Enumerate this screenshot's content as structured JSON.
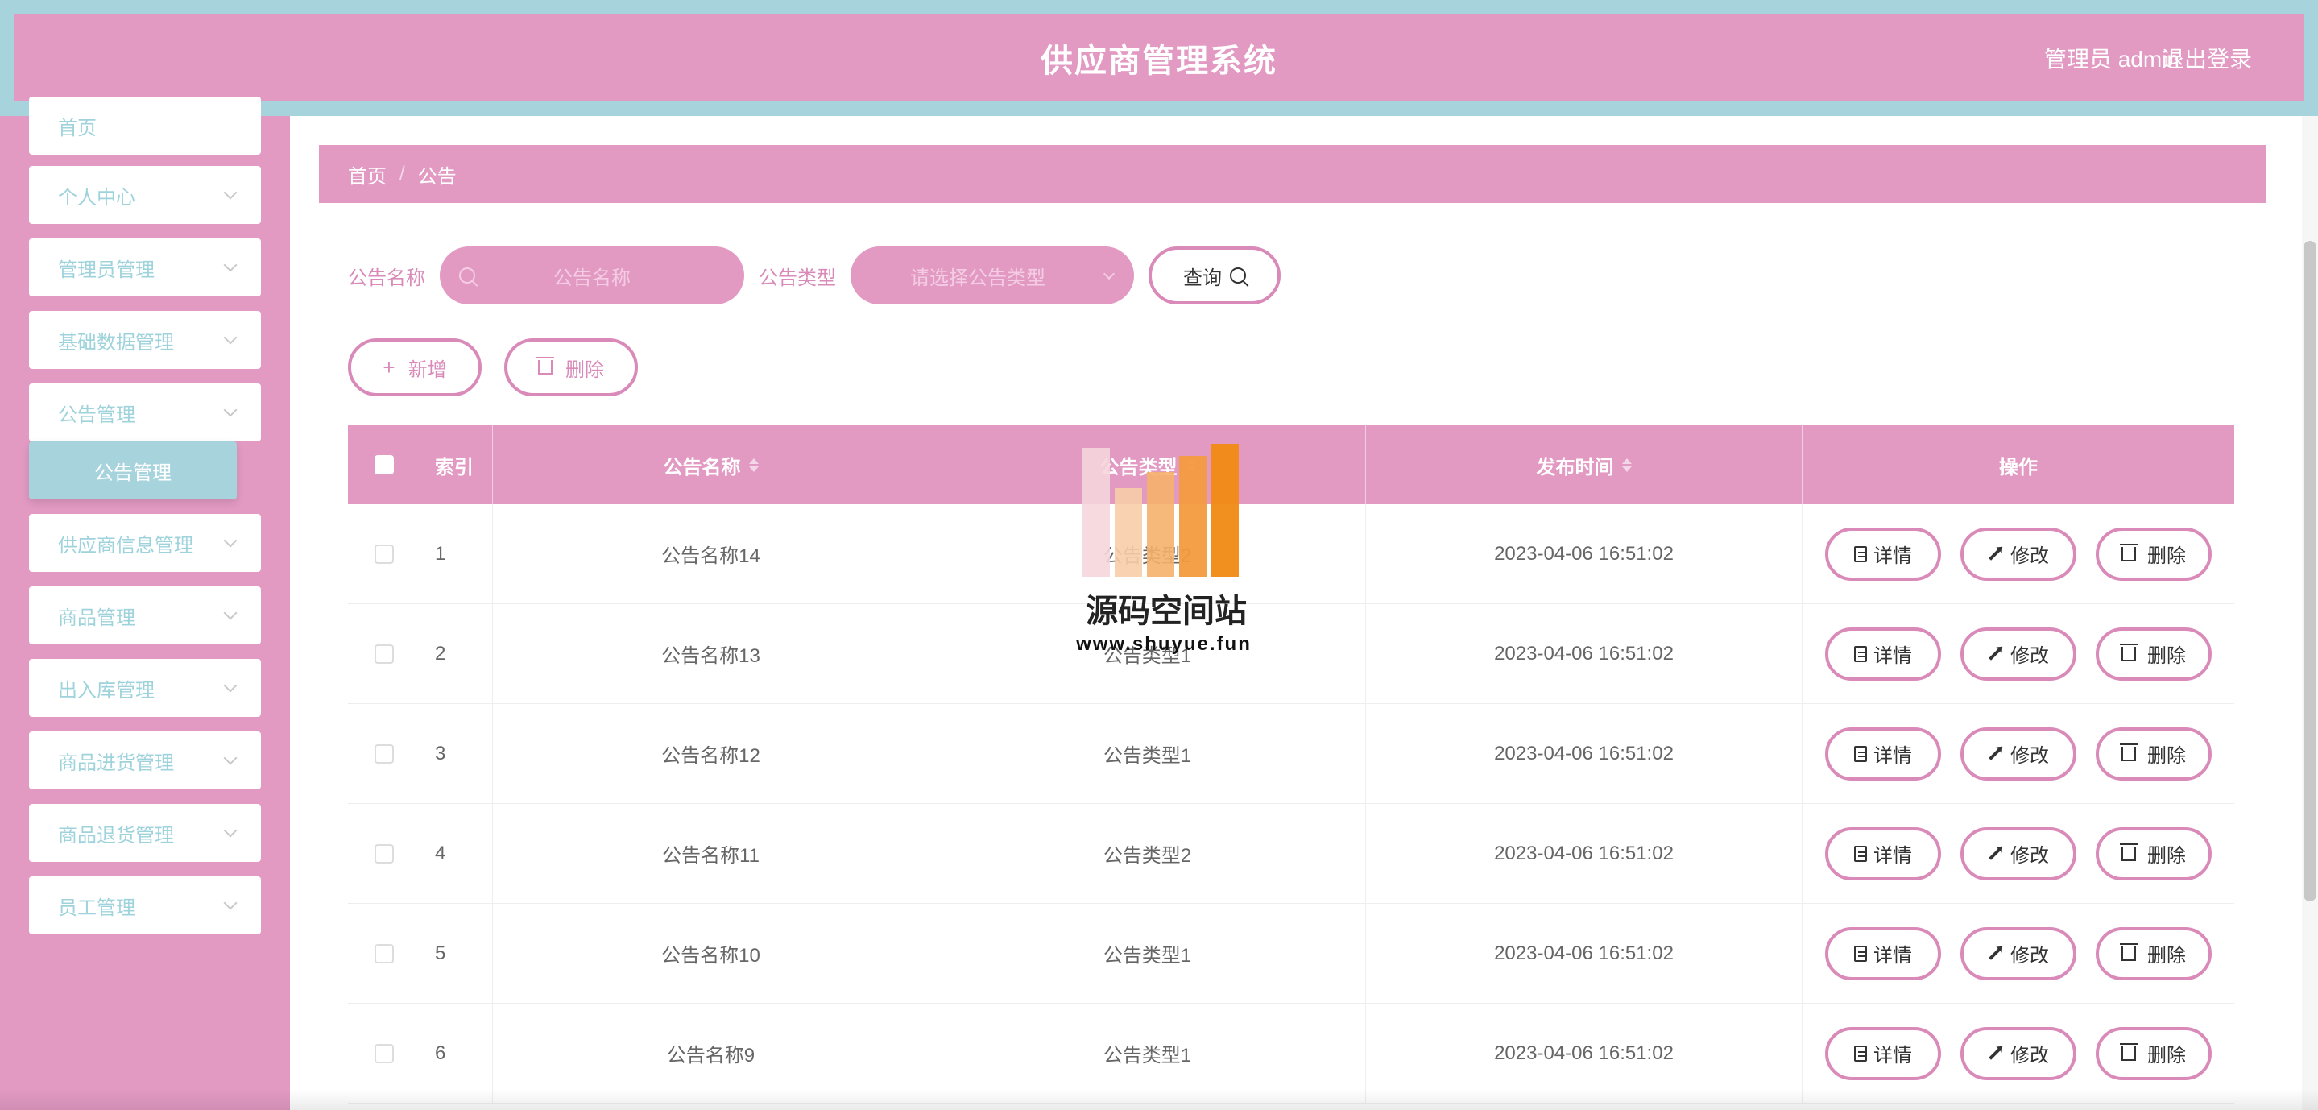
{
  "header": {
    "title": "供应商管理系统",
    "user_label": "管理员 admin",
    "logout_label": "退出登录"
  },
  "sidebar": {
    "items": [
      {
        "label": "首页"
      },
      {
        "label": "个人中心"
      },
      {
        "label": "管理员管理"
      },
      {
        "label": "基础数据管理"
      },
      {
        "label": "公告管理"
      },
      {
        "label": "供应商信息管理"
      },
      {
        "label": "商品管理"
      },
      {
        "label": "出入库管理"
      },
      {
        "label": "商品进货管理"
      },
      {
        "label": "商品退货管理"
      },
      {
        "label": "员工管理"
      }
    ],
    "active_sub": "公告管理"
  },
  "breadcrumb": {
    "home": "首页",
    "separator": "/",
    "current": "公告"
  },
  "filters": {
    "name_label": "公告名称",
    "name_placeholder": "公告名称",
    "type_label": "公告类型",
    "type_placeholder": "请选择公告类型",
    "search_button": "查询"
  },
  "actions": {
    "add_label": "新增",
    "delete_label": "删除"
  },
  "table": {
    "headers": {
      "index": "索引",
      "name": "公告名称",
      "type": "公告类型",
      "time": "发布时间",
      "ops": "操作"
    },
    "rows": [
      {
        "index": "1",
        "name": "公告名称14",
        "type": "公告类型2",
        "time": "2023-04-06 16:51:02"
      },
      {
        "index": "2",
        "name": "公告名称13",
        "type": "公告类型1",
        "time": "2023-04-06 16:51:02"
      },
      {
        "index": "3",
        "name": "公告名称12",
        "type": "公告类型1",
        "time": "2023-04-06 16:51:02"
      },
      {
        "index": "4",
        "name": "公告名称11",
        "type": "公告类型2",
        "time": "2023-04-06 16:51:02"
      },
      {
        "index": "5",
        "name": "公告名称10",
        "type": "公告类型1",
        "time": "2023-04-06 16:51:02"
      },
      {
        "index": "6",
        "name": "公告名称9",
        "type": "公告类型1",
        "time": "2023-04-06 16:51:02"
      }
    ],
    "op_labels": {
      "detail": "详情",
      "edit": "修改",
      "delete": "删除"
    }
  },
  "watermark": {
    "title": "源码空间站",
    "url": "www.shuyue.fun"
  },
  "colors": {
    "primary_pink": "#e29ac3",
    "teal": "#a7d3dc"
  }
}
